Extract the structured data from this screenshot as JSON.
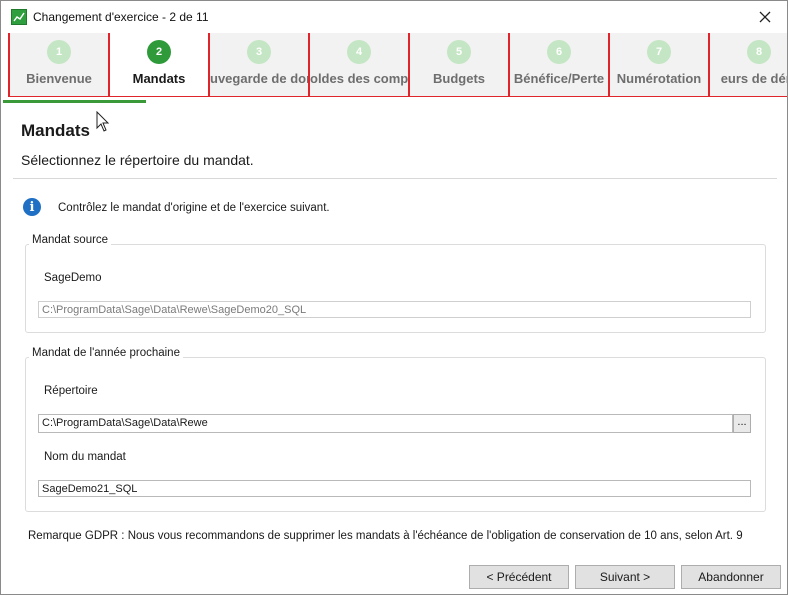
{
  "window": {
    "title": "Changement d'exercice - 2 de 11"
  },
  "steps": [
    {
      "number": "1",
      "label": "Bienvenue",
      "active": false
    },
    {
      "number": "2",
      "label": "Mandats",
      "active": true
    },
    {
      "number": "3",
      "label": "uvegarde de donn",
      "active": false
    },
    {
      "number": "4",
      "label": "oldes des compt",
      "active": false
    },
    {
      "number": "5",
      "label": "Budgets",
      "active": false
    },
    {
      "number": "6",
      "label": "Bénéfice/Perte",
      "active": false
    },
    {
      "number": "7",
      "label": "Numérotation",
      "active": false
    },
    {
      "number": "8",
      "label": "eurs de dém",
      "active": false
    }
  ],
  "page": {
    "title": "Mandats",
    "subtitle": "Sélectionnez le répertoire du mandat."
  },
  "info": {
    "text": "Contrôlez le mandat d'origine et de l'exercice suivant."
  },
  "source_group": {
    "legend": "Mandat source",
    "name": "SageDemo",
    "path": "C:\\ProgramData\\Sage\\Data\\Rewe\\SageDemo20_SQL"
  },
  "next_group": {
    "legend": "Mandat de l'année prochaine",
    "directory_label": "Répertoire",
    "directory_value": "C:\\ProgramData\\Sage\\Data\\Rewe",
    "browse_label": "...",
    "name_label": "Nom du mandat",
    "name_value": "SageDemo21_SQL"
  },
  "remark": "Remarque GDPR : Nous vous recommandons de supprimer les mandats à l'échéance de l'obligation de conservation de 10 ans, selon Art. 9",
  "buttons": {
    "previous": "< Précédent",
    "next": "Suivant >",
    "cancel": "Abandonner"
  },
  "colors": {
    "step_border": "#e0242b",
    "active_step": "#2e9a3a",
    "inactive_step": "#c4e6c4",
    "info_icon": "#1f6fc5"
  },
  "icons": {
    "app": "chart-icon",
    "close": "close-icon",
    "info": "info-icon"
  }
}
